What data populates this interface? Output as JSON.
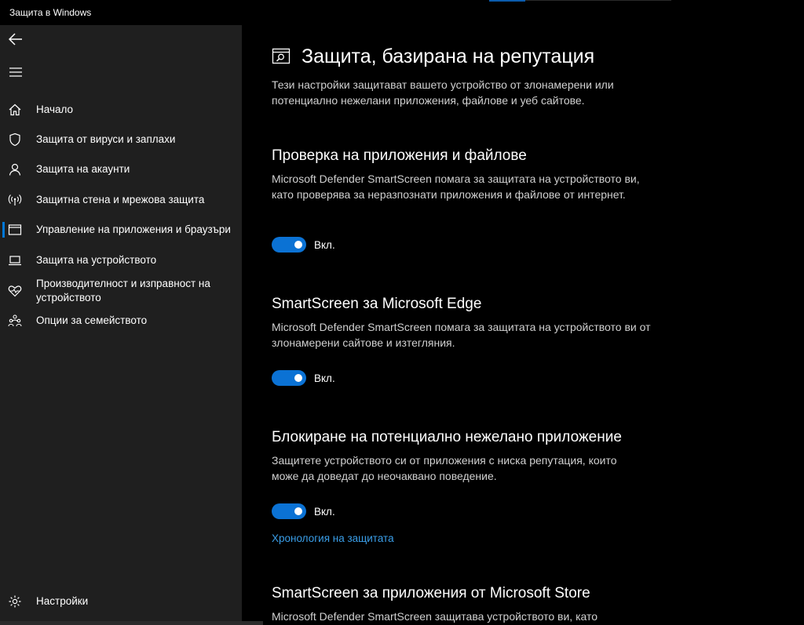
{
  "window": {
    "title": "Защита в Windows"
  },
  "sidebar": {
    "items": [
      {
        "label": "Начало",
        "icon": "home-icon"
      },
      {
        "label": "Защита от вируси и заплахи",
        "icon": "shield-icon"
      },
      {
        "label": "Защита на акаунти",
        "icon": "person-icon"
      },
      {
        "label": "Защитна стена и мрежова защита",
        "icon": "wifi-antenna-icon"
      },
      {
        "label": "Управление на приложения и браузъри",
        "icon": "app-window-icon",
        "active": true
      },
      {
        "label": "Защита на устройството",
        "icon": "laptop-icon"
      },
      {
        "label": "Производителност и изправност на устройството",
        "icon": "heart-pulse-icon"
      },
      {
        "label": "Опции за семейството",
        "icon": "family-icon"
      }
    ],
    "settings_label": "Настройки"
  },
  "main": {
    "title": "Защита, базирана на репутация",
    "description": "Тези настройки защитават вашето устройство от злонамерени или потенциално нежелани приложения, файлове и уеб сайтове.",
    "sections": [
      {
        "heading": "Проверка на приложения и файлове",
        "description": "Microsoft Defender SmartScreen помага за защитата на устройството ви, като проверява за неразпознати приложения и файлове от интернет.",
        "toggle_label": "Вкл."
      },
      {
        "heading": "SmartScreen за Microsoft Edge",
        "description": "Microsoft Defender SmartScreen помага за защитата на устройството ви от злонамерени сайтове и изтегляния.",
        "toggle_label": "Вкл."
      },
      {
        "heading": "Блокиране на потенциално нежелано приложение",
        "description": "Защитете устройството си от приложения с ниска репутация, които може да доведат до неочаквано поведение.",
        "toggle_label": "Вкл.",
        "link": "Хронология на защитата"
      },
      {
        "heading": "SmartScreen за приложения от Microsoft Store",
        "description": "Microsoft Defender SmartScreen защитава устройството ви, като"
      }
    ]
  },
  "colors": {
    "accent": "#0078d7",
    "toggle_on": "#0b72d4",
    "link": "#3a9ee8",
    "sidebar_bg": "#1f1f1f",
    "main_bg": "#000000"
  }
}
